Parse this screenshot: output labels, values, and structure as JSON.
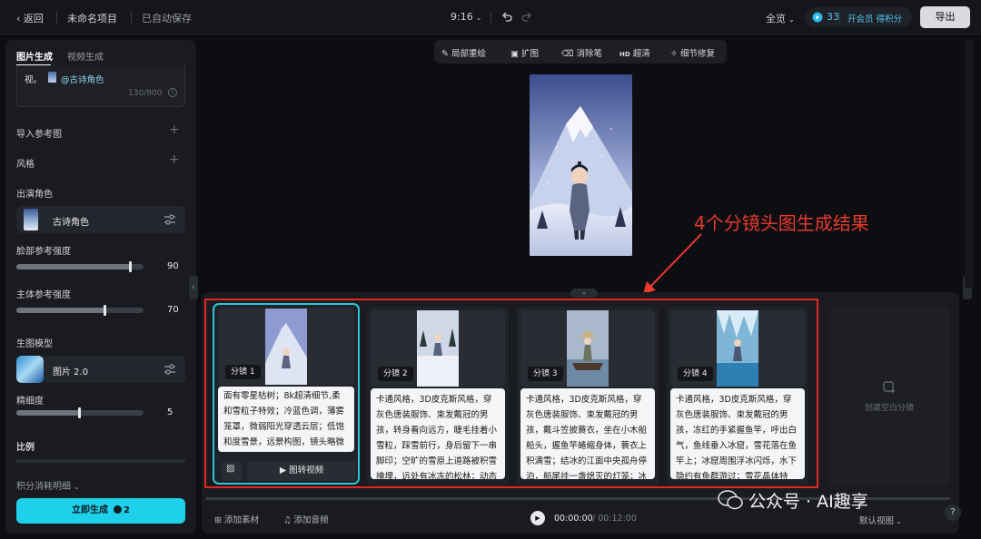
{
  "topbar": {
    "back_label": "返回",
    "project_name": "未命名项目",
    "save_status": "已自动保存",
    "ratio": "9:16",
    "view_label": "全览",
    "credits": "33",
    "member_label": "开会员 得积分",
    "export_label": "导出"
  },
  "sidebar": {
    "tabs": [
      "图片生成",
      "视频生成"
    ],
    "prompt_tail": "视。",
    "prompt_mention": "@古诗角色",
    "char_count": "130/800",
    "import_ref_label": "导入参考图",
    "style_label": "风格",
    "cast_label": "出演角色",
    "character_name": "古诗角色",
    "face_ref_label": "脸部参考强度",
    "face_ref_value": "90",
    "subject_ref_label": "主体参考强度",
    "subject_ref_value": "70",
    "model_label": "生图模型",
    "model_name": "图片 2.0",
    "detail_label": "精细度",
    "detail_value": "5",
    "ratio_label": "比例",
    "cost_label": "积分消耗明细",
    "generate_label": "立即生成",
    "generate_cost": "2"
  },
  "levels": {
    "face_ref": 0.9,
    "subject_ref": 0.7,
    "detail": 0.5
  },
  "toolbar": {
    "items": [
      "局部重绘",
      "扩图",
      "消除笔",
      "超清",
      "细节修复"
    ],
    "hd_badge": "HD"
  },
  "annotation": "4个分镜头图生成结果",
  "shots": [
    {
      "tag": "分镜 1",
      "prompt": "面有零星枯树；8k超清细节,柔和雪粒子特效；冷蓝色调，薄雾笼罩，微弱阳光穿透云层；低饱和度雪景，远景构图，镜头略微俯视。"
    },
    {
      "tag": "分镜 2",
      "prompt": "卡通风格，3D皮克斯风格，穿灰色唐装服饰、束发戴冠的男孩，转身看向远方，睫毛挂着小雪粒，踩雪前行，身后留下一串脚印；空旷的雪原上道路被积雪掩埋，远处有冰冻的松林；动态"
    },
    {
      "tag": "分镜 3",
      "prompt": "卡通风格，3D皮克斯风格，穿灰色唐装服饰、束发戴冠的男孩，戴斗笠披蓑衣，坐在小木船船头，握鱼竿蜷缩身体，蓑衣上积满雪；结冰的江面中央孤舟停泊，船尾挂一盏熄灭的灯笼；冰"
    },
    {
      "tag": "分镜 4",
      "prompt": "卡通风格，3D皮克斯风格，穿灰色唐装服饰、束发戴冠的男孩，冻红的手紧握鱼竿，呼出白气，鱼线垂入冰窟，雪花落在鱼竿上；冰窟周围浮冰闪烁，水下隐约有鱼群游过；雪花晶体特"
    }
  ],
  "card1_video_label": "图转视频",
  "blank_shot_label": "创建空白分镜",
  "bottom": {
    "add_material": "添加素材",
    "add_audio": "添加音频",
    "time_current": "00:00:00",
    "time_total": "/ 00:12:00",
    "view_mode": "默认视图"
  },
  "watermark": "公众号 · AI趣享",
  "colors": {
    "accent": "#1fd0ea",
    "annotation": "#e83a2e",
    "selected_border": "#28c6d8"
  }
}
